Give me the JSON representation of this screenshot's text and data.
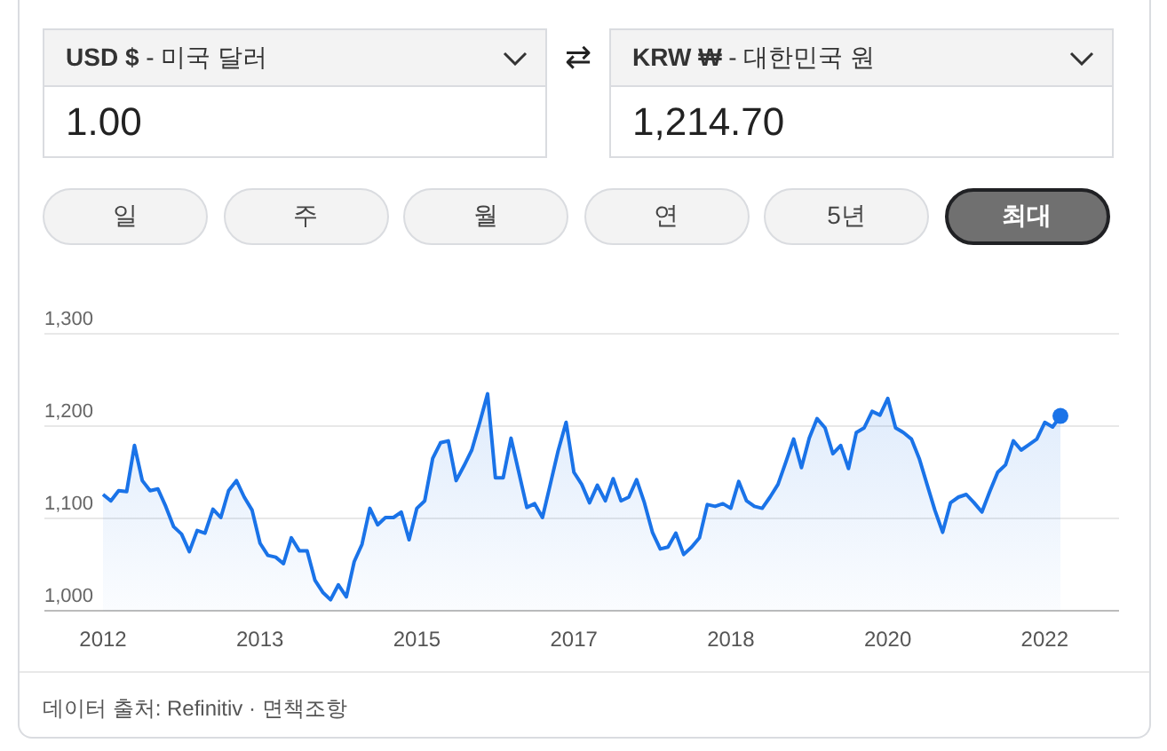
{
  "converter": {
    "from": {
      "label": "**USD $** - 미국 달러",
      "value": "1.00"
    },
    "swap": "⇄",
    "to": {
      "label": "**KRW ₩** - 대한민국 원",
      "value": "1,214.70"
    }
  },
  "ranges": [
    {
      "label": "일",
      "selected": false
    },
    {
      "label": "주",
      "selected": false
    },
    {
      "label": "월",
      "selected": false
    },
    {
      "label": "연",
      "selected": false
    },
    {
      "label": "5년",
      "selected": false
    },
    {
      "label": "최대",
      "selected": true
    }
  ],
  "chart": {
    "chart_data": {
      "type": "area",
      "ylim": [
        1000,
        1300
      ],
      "yticks": [
        {
          "value": 1000,
          "label": "1,000"
        },
        {
          "value": 1100,
          "label": "1,100"
        },
        {
          "value": 1200,
          "label": "1,200"
        },
        {
          "value": 1300,
          "label": "1,300"
        }
      ],
      "categories": [
        "2012",
        null,
        null,
        null,
        null,
        null,
        null,
        null,
        null,
        null,
        null,
        null,
        null,
        null,
        null,
        null,
        null,
        null,
        null,
        null,
        "2013",
        null,
        null,
        null,
        null,
        null,
        null,
        null,
        null,
        null,
        null,
        null,
        null,
        null,
        null,
        null,
        null,
        null,
        null,
        null,
        "2015",
        null,
        null,
        null,
        null,
        null,
        null,
        null,
        null,
        null,
        null,
        null,
        null,
        null,
        null,
        null,
        null,
        null,
        null,
        null,
        "2017",
        null,
        null,
        null,
        null,
        null,
        null,
        null,
        null,
        null,
        null,
        null,
        null,
        null,
        null,
        null,
        null,
        null,
        null,
        null,
        "2018",
        null,
        null,
        null,
        null,
        null,
        null,
        null,
        null,
        null,
        null,
        null,
        null,
        null,
        null,
        null,
        null,
        null,
        null,
        null,
        "2020",
        null,
        null,
        null,
        null,
        null,
        null,
        null,
        null,
        null,
        null,
        null,
        null,
        null,
        null,
        null,
        null,
        null,
        null,
        null,
        "2022",
        null,
        null
      ],
      "series": [
        {
          "color": "#1a73e8",
          "values": [
            1126,
            1119,
            1130,
            1129,
            1179,
            1141,
            1130,
            1132,
            1113,
            1091,
            1083,
            1064,
            1087,
            1084,
            1110,
            1101,
            1130,
            1141,
            1123,
            1109,
            1073,
            1060,
            1058,
            1051,
            1079,
            1065,
            1065,
            1033,
            1020,
            1012,
            1028,
            1015,
            1053,
            1072,
            1111,
            1093,
            1101,
            1101,
            1107,
            1077,
            1111,
            1119,
            1165,
            1182,
            1184,
            1141,
            1157,
            1174,
            1204,
            1235,
            1144,
            1144,
            1187,
            1149,
            1112,
            1116,
            1101,
            1137,
            1173,
            1204,
            1150,
            1137,
            1117,
            1136,
            1119,
            1143,
            1119,
            1123,
            1142,
            1117,
            1085,
            1067,
            1069,
            1084,
            1061,
            1069,
            1079,
            1115,
            1113,
            1116,
            1111,
            1140,
            1119,
            1113,
            1111,
            1123,
            1137,
            1161,
            1186,
            1155,
            1187,
            1208,
            1198,
            1170,
            1179,
            1154,
            1193,
            1198,
            1216,
            1212,
            1230,
            1198,
            1193,
            1186,
            1165,
            1137,
            1109,
            1085,
            1117,
            1123,
            1126,
            1117,
            1107,
            1129,
            1150,
            1158,
            1184,
            1174,
            1180,
            1186,
            1204,
            1199,
            1211
          ]
        }
      ]
    }
  },
  "footer": {
    "source": "데이터 출처: Refinitiv · ",
    "link": "면책조항"
  }
}
